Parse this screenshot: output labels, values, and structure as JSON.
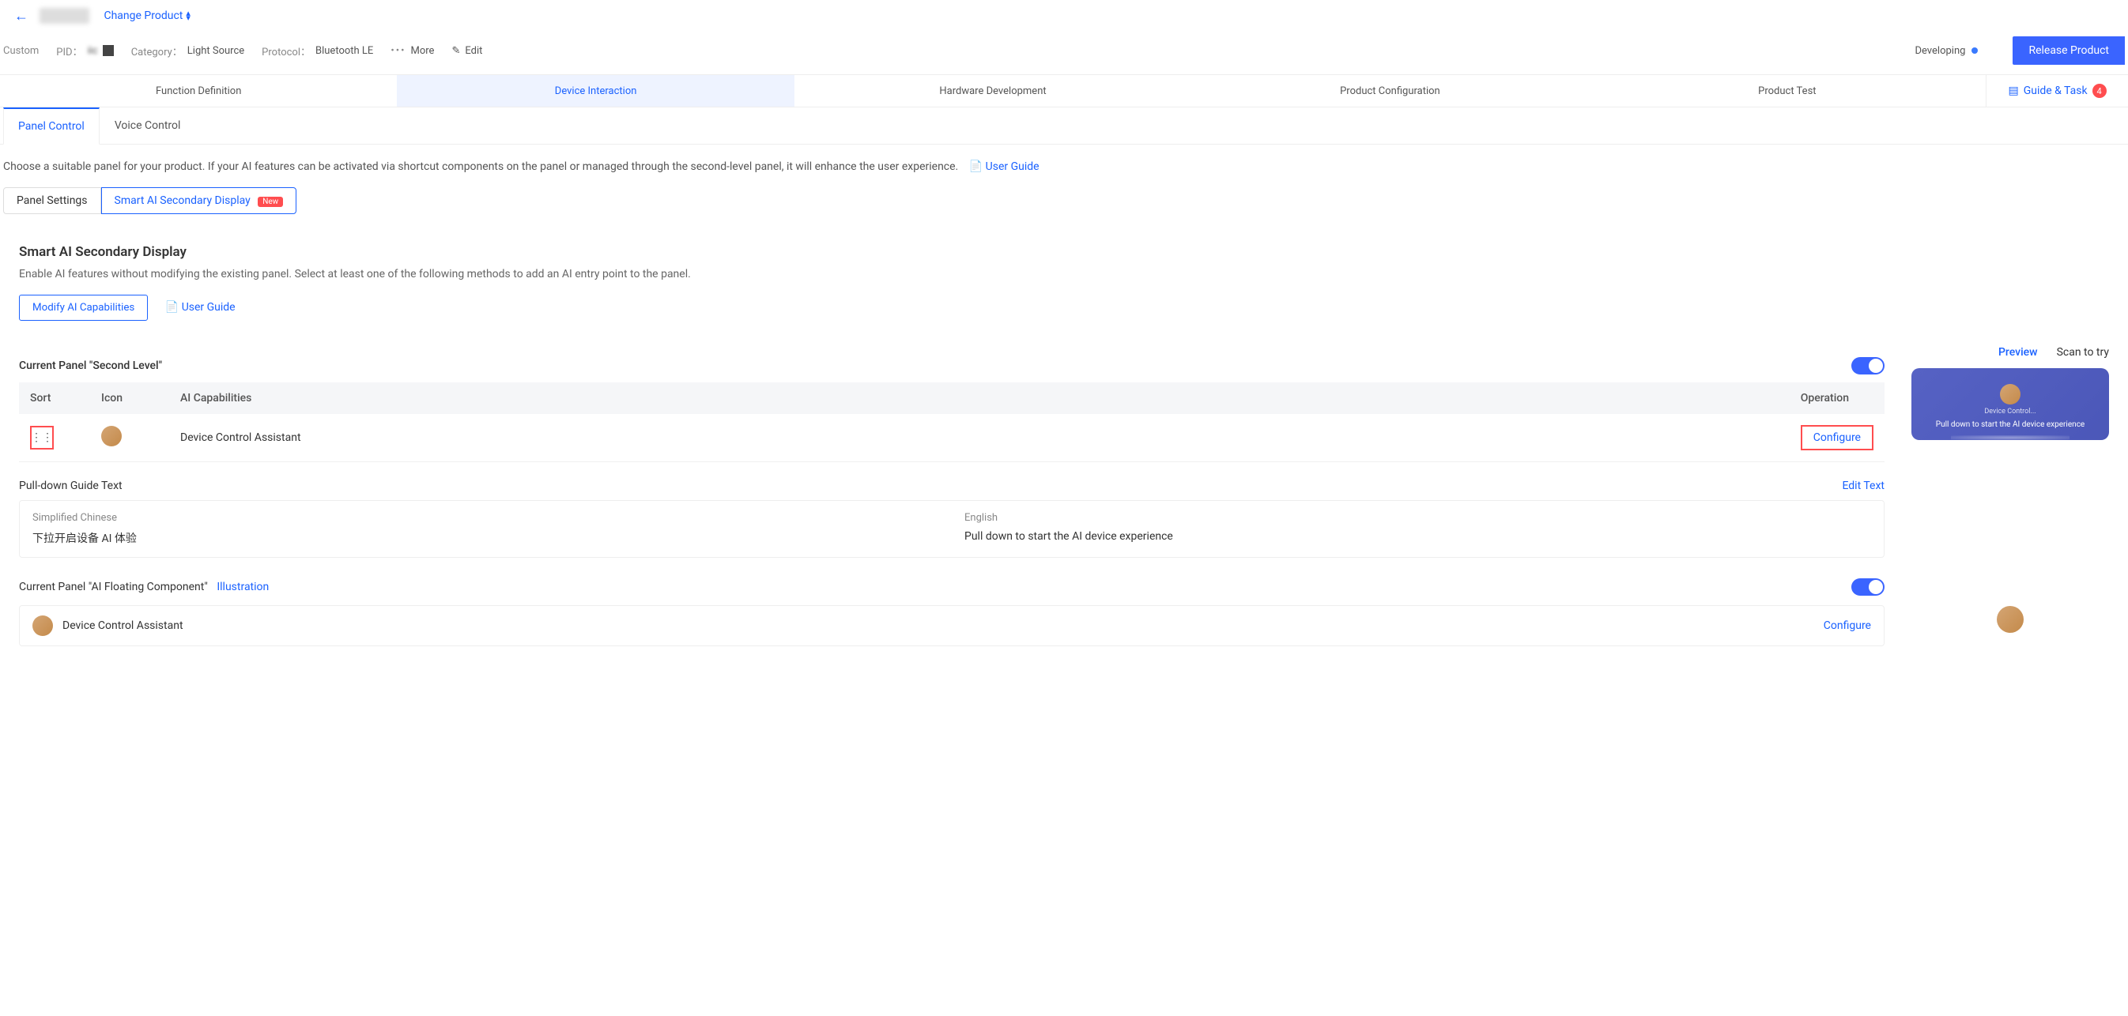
{
  "header": {
    "change_product": "Change Product",
    "status": "Developing",
    "release_btn": "Release Product"
  },
  "meta": {
    "custom": "Custom",
    "pid_label": "PID：",
    "pid_value": "iic",
    "category_label": "Category：",
    "category_value": "Light Source",
    "protocol_label": "Protocol：",
    "protocol_value": "Bluetooth LE",
    "more": "More",
    "edit": "Edit"
  },
  "stepper": {
    "steps": [
      "Function Definition",
      "Device Interaction",
      "Hardware Development",
      "Product Configuration",
      "Product Test"
    ],
    "active_index": 1,
    "guide_task": "Guide & Task",
    "guide_count": "4"
  },
  "tabs": {
    "items": [
      "Panel Control",
      "Voice Control"
    ],
    "active_index": 0
  },
  "desc": {
    "text": "Choose a suitable panel for your product. If your AI features can be activated via shortcut components on the panel or managed through the second-level panel, it will enhance the user experience.",
    "user_guide": "User Guide"
  },
  "subtabs": {
    "items": [
      "Panel Settings",
      "Smart AI Secondary Display"
    ],
    "active_index": 1,
    "new_badge": "New"
  },
  "section": {
    "title": "Smart AI Secondary Display",
    "desc": "Enable AI features without modifying the existing panel. Select at least one of the following methods to add an AI entry point to the panel.",
    "modify_btn": "Modify AI Capabilities",
    "user_guide": "User Guide"
  },
  "second_level": {
    "title": "Current Panel \"Second Level\"",
    "columns": [
      "Sort",
      "Icon",
      "AI Capabilities",
      "Operation"
    ],
    "rows": [
      {
        "capability": "Device Control Assistant",
        "operation": "Configure"
      }
    ]
  },
  "pulldown": {
    "title": "Pull-down Guide Text",
    "edit": "Edit Text",
    "langs": [
      {
        "label": "Simplified Chinese",
        "value": "下拉开启设备 AI 体验"
      },
      {
        "label": "English",
        "value": "Pull down to start the AI device experience"
      }
    ]
  },
  "floating": {
    "title": "Current Panel \"AI Floating Component\"",
    "illustration": "Illustration",
    "item": "Device Control Assistant",
    "configure": "Configure"
  },
  "preview": {
    "tabs": [
      "Preview",
      "Scan to try"
    ],
    "active_index": 0,
    "card_sub": "Device Control...",
    "card_text": "Pull down to start the AI device experience"
  }
}
